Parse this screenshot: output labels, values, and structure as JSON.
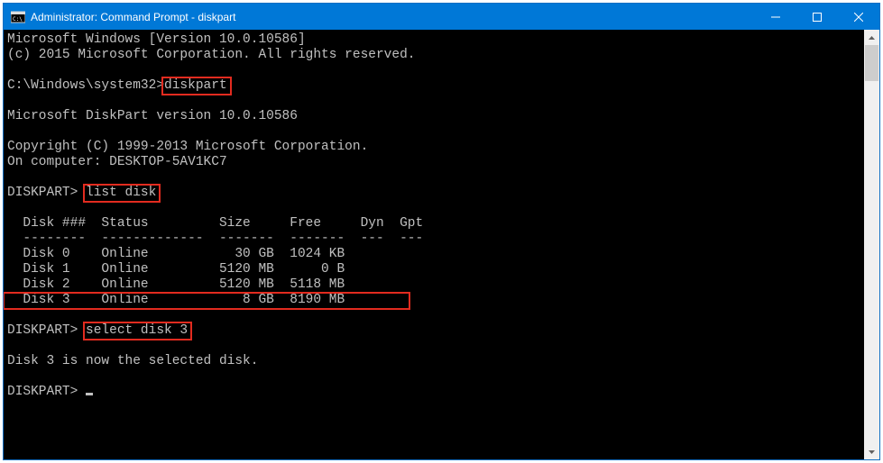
{
  "window": {
    "title": "Administrator: Command Prompt - diskpart"
  },
  "lines": {
    "l1": "Microsoft Windows [Version 10.0.10586]",
    "l2": "(c) 2015 Microsoft Corporation. All rights reserved.",
    "prompt1_pre": "C:\\Windows\\system32>",
    "prompt1_cmd": "diskpart",
    "l4": "Microsoft DiskPart version 10.0.10586",
    "l5": "Copyright (C) 1999-2013 Microsoft Corporation.",
    "l6": "On computer: DESKTOP-5AV1KC7",
    "dp1_pre": "DISKPART> ",
    "dp1_cmd": "list disk",
    "thead": "  Disk ###  Status         Size     Free     Dyn  Gpt",
    "tsep": "  --------  -------------  -------  -------  ---  ---",
    "tr0": "  Disk 0    Online           30 GB  1024 KB",
    "tr1": "  Disk 1    Online         5120 MB      0 B",
    "tr2": "  Disk 2    Online         5120 MB  5118 MB",
    "tr3": "  Disk 3    Online            8 GB  8190 MB        ",
    "dp2_pre": "DISKPART> ",
    "dp2_cmd": "select disk 3",
    "sel": "Disk 3 is now the selected disk.",
    "dp3": "DISKPART> "
  }
}
